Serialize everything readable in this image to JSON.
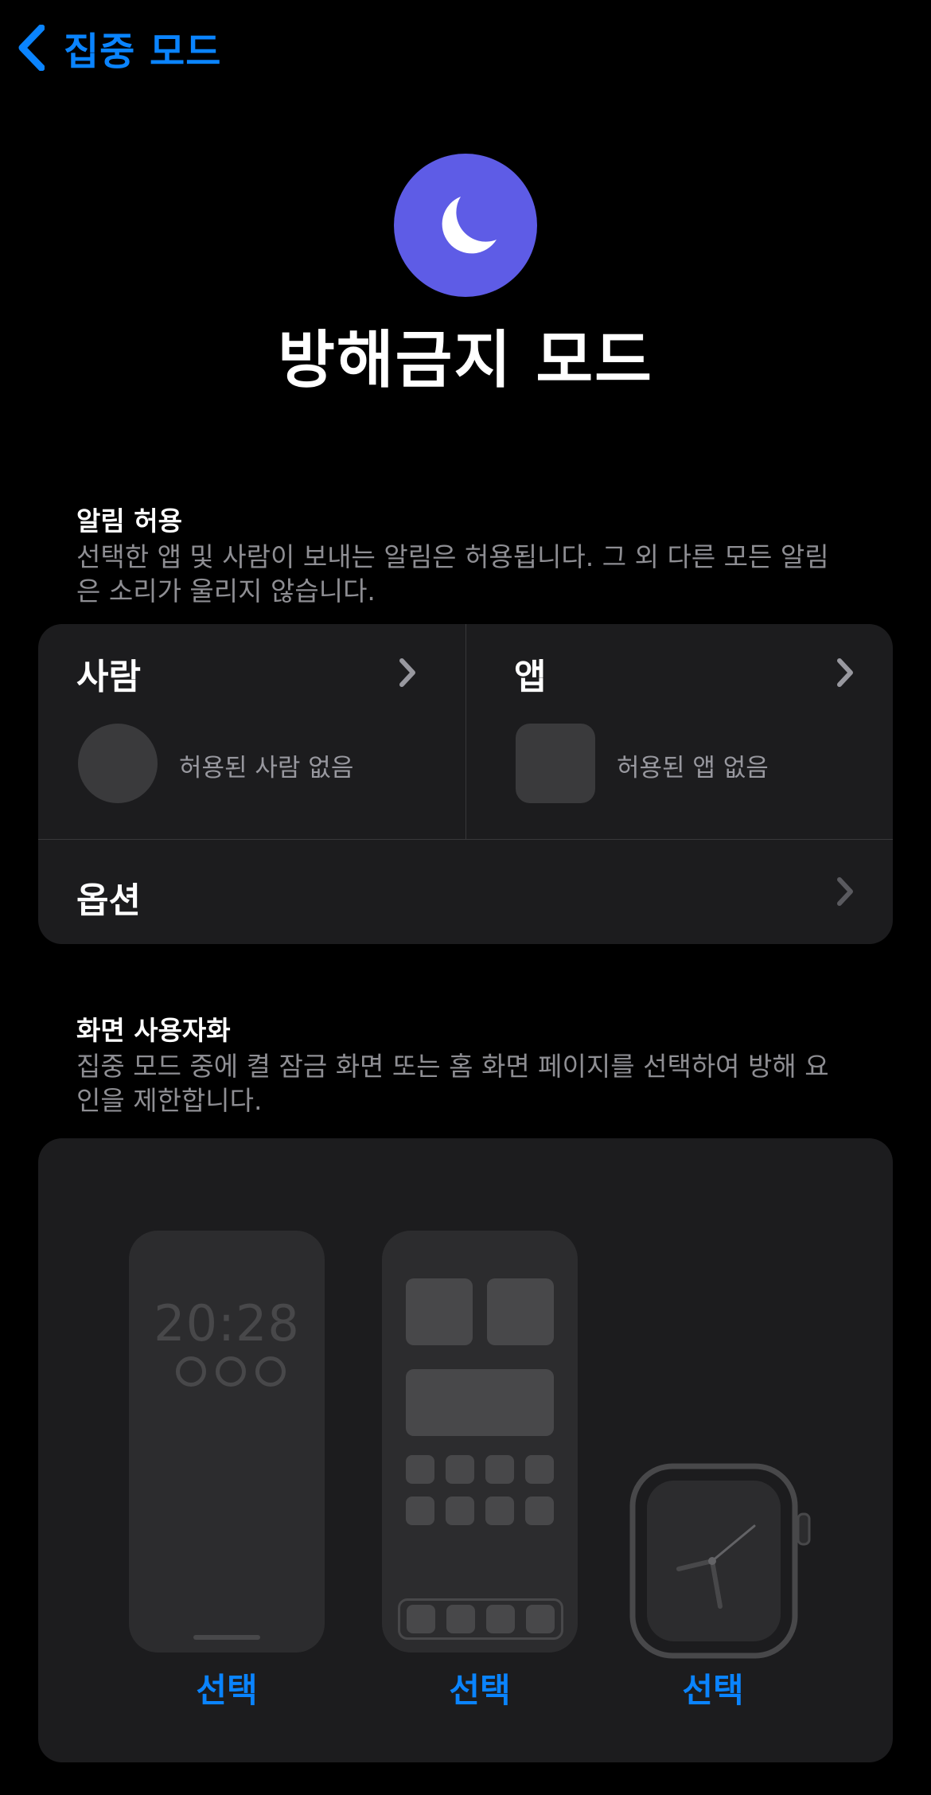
{
  "nav": {
    "back_label": "집중 모드"
  },
  "header": {
    "title": "방해금지 모드",
    "icon": "moon-icon",
    "icon_color": "#5e5ce6"
  },
  "allowed_notifications": {
    "title": "알림 허용",
    "description": "선택한 앱 및 사람이 보내는 알림은 허용됩니다. 그 외 다른 모든 알림은 소리가 울리지 않습니다.",
    "people": {
      "label": "사람",
      "empty_text": "허용된 사람 없음"
    },
    "apps": {
      "label": "앱",
      "empty_text": "허용된 앱 없음"
    },
    "options": {
      "label": "옵션"
    }
  },
  "customize_screens": {
    "title": "화면 사용자화",
    "description": "집중 모드 중에 켤 잠금 화면 또는 홈 화면 페이지를 선택하여 방해 요인을 제한합니다.",
    "lock_screen": {
      "time": "20:28",
      "select_label": "선택"
    },
    "home_screen": {
      "select_label": "선택"
    },
    "watch_face": {
      "select_label": "선택"
    }
  },
  "colors": {
    "accent": "#0a84ff",
    "card_bg": "#1c1c1e",
    "background": "#000000"
  }
}
